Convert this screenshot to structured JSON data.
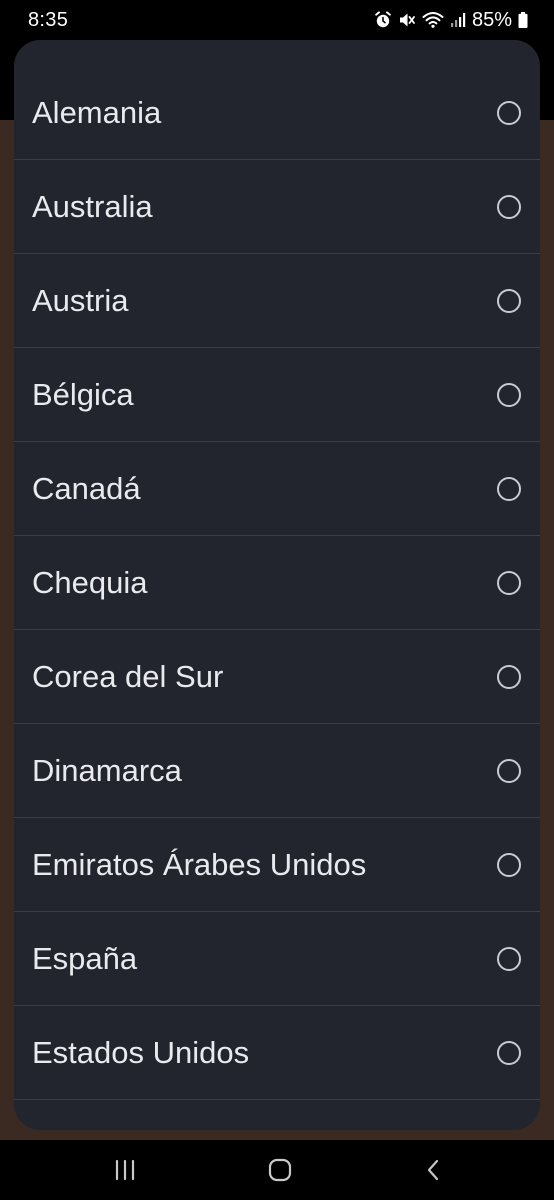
{
  "status_bar": {
    "time": "8:35",
    "battery_percent": "85%",
    "icons": [
      "alarm-icon",
      "mute-icon",
      "wifi-icon",
      "signal-icon",
      "battery-icon"
    ]
  },
  "country_list": {
    "items": [
      {
        "label": "Alemania",
        "selected": false
      },
      {
        "label": "Australia",
        "selected": false
      },
      {
        "label": "Austria",
        "selected": false
      },
      {
        "label": "Bélgica",
        "selected": false
      },
      {
        "label": "Canadá",
        "selected": false
      },
      {
        "label": "Chequia",
        "selected": false
      },
      {
        "label": "Corea del Sur",
        "selected": false
      },
      {
        "label": "Dinamarca",
        "selected": false
      },
      {
        "label": "Emiratos Árabes Unidos",
        "selected": false
      },
      {
        "label": "España",
        "selected": false
      },
      {
        "label": "Estados Unidos",
        "selected": false
      }
    ]
  },
  "nav_bar": {
    "buttons": [
      "recent-apps-icon",
      "home-icon",
      "back-icon"
    ]
  },
  "colors": {
    "sheet_background": "#22252e",
    "backdrop": "#3b2a22",
    "text": "#e9eaee",
    "divider": "#3a3e48"
  }
}
